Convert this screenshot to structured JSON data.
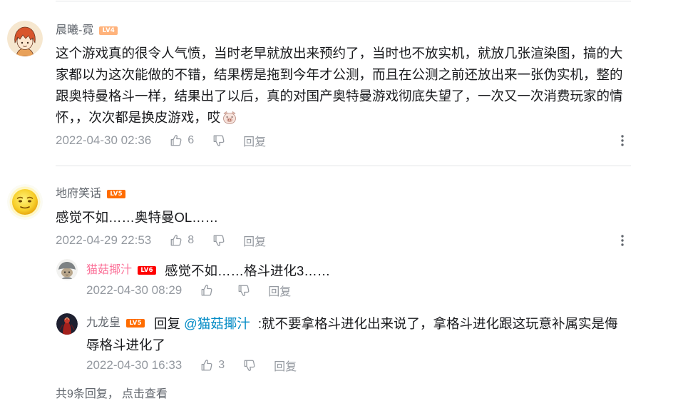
{
  "colors": {
    "username": "#61666d",
    "vip_username": "#fb7299",
    "content_text": "#18191c",
    "meta_text": "#9499a0",
    "mention_link": "#008ac5",
    "divider": "#e3e5e7",
    "lv4": "#ffb37c",
    "lv5": "#ff6c00",
    "lv6": "#ff0000"
  },
  "icons": {
    "like": "thumbs-up-icon",
    "dislike": "thumbs-down-icon",
    "more": "more-vertical-icon"
  },
  "comments": [
    {
      "avatar": "red-hair-cartoon-avatar",
      "username": "晨曦-霓",
      "level": "LV4",
      "content_lines": [
        "这个游戏真的很令人气愤，当时老早就放出来预约了，当时也不放实机，就放几张渲染图，搞的大",
        "家都以为这次能做的不错，结果楞是拖到今年才公测，而且在公测之前还放出来一张伪实机，整的",
        "跟奥特曼格斗一样，结果出了以后，真的对国产奥特曼游戏彻底失望了，一次又一次消费玩家的情",
        "怀，，次次都是换皮游戏，哎"
      ],
      "emoji": "pig-face-emoji",
      "time": "2022-04-30 02:36",
      "like_count": "6",
      "reply_label": "回复"
    },
    {
      "avatar": "yellow-emoji-face-avatar",
      "username": "地府笑话",
      "level": "LV5",
      "content": "感觉不如……奥特曼OL……",
      "time": "2022-04-29 22:53",
      "like_count": "8",
      "reply_label": "回复",
      "replies": [
        {
          "avatar": "gray-mushroom-cartoon-avatar",
          "username": "猫菇揶汁",
          "level": "LV6",
          "content": "感觉不如……格斗进化3……",
          "time": "2022-04-30 08:29",
          "reply_label": "回复"
        },
        {
          "avatar": "dark-red-figure-avatar",
          "username": "九龙皇",
          "level": "LV5",
          "reply_prefix": "回复",
          "mention": "@猫菇揶汁",
          "content_lines": [
            ":就不要拿格斗进化出来说了，拿格斗进化跟这玩意补属实是侮",
            "辱格斗进化了"
          ],
          "time": "2022-04-30 16:33",
          "like_count": "3",
          "reply_label": "回复"
        }
      ],
      "reply_summary": {
        "count_text": "共9条回复，",
        "view_link": "点击查看"
      }
    }
  ]
}
